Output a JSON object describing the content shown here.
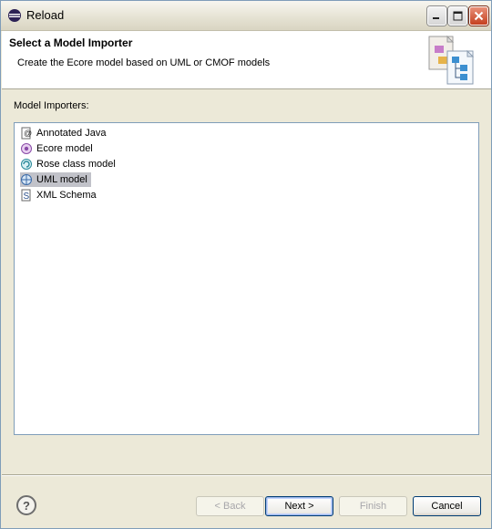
{
  "window": {
    "title": "Reload"
  },
  "banner": {
    "title": "Select a Model Importer",
    "description": "Create the Ecore model based on UML or CMOF models"
  },
  "importers": {
    "label": "Model Importers:",
    "items": [
      {
        "label": "Annotated Java",
        "icon": "java-annotation-icon",
        "selected": false
      },
      {
        "label": "Ecore model",
        "icon": "ecore-icon",
        "selected": false
      },
      {
        "label": "Rose class model",
        "icon": "rose-icon",
        "selected": false
      },
      {
        "label": "UML model",
        "icon": "uml-icon",
        "selected": true
      },
      {
        "label": "XML Schema",
        "icon": "xml-schema-icon",
        "selected": false
      }
    ]
  },
  "buttons": {
    "back": "< Back",
    "next": "Next >",
    "finish": "Finish",
    "cancel": "Cancel"
  },
  "colors": {
    "selection": "#c1c2c9",
    "border": "#7f9db9",
    "background": "#ece9d8"
  }
}
